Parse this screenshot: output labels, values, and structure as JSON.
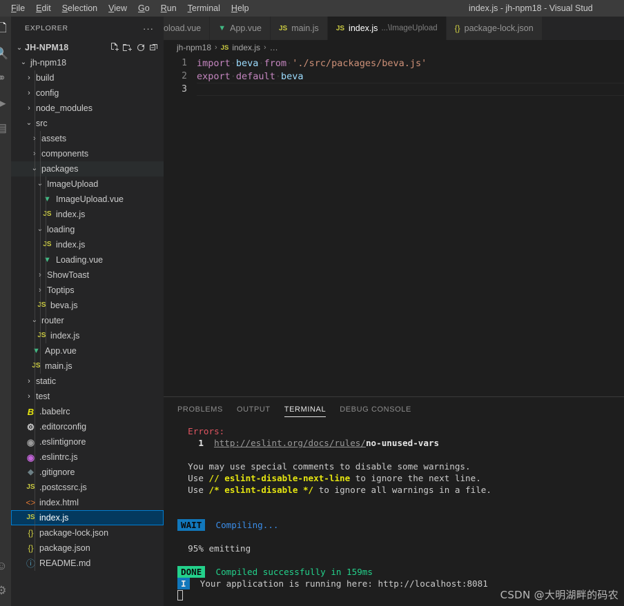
{
  "window": {
    "title": "index.js - jh-npm18 - Visual Stud"
  },
  "menubar": {
    "items": [
      {
        "label": "File"
      },
      {
        "label": "Edit"
      },
      {
        "label": "Selection"
      },
      {
        "label": "View"
      },
      {
        "label": "Go"
      },
      {
        "label": "Run"
      },
      {
        "label": "Terminal"
      },
      {
        "label": "Help"
      }
    ]
  },
  "sidebar": {
    "title": "EXPLORER",
    "more_actions": "···",
    "root": {
      "label": "JH-NPM18",
      "chevron": "⌄",
      "actions": [
        {
          "name": "new-file-icon",
          "title": "New File"
        },
        {
          "name": "new-folder-icon",
          "title": "New Folder"
        },
        {
          "name": "refresh-icon",
          "title": "Refresh Explorer"
        },
        {
          "name": "collapse-all-icon",
          "title": "Collapse Folders in Explorer"
        }
      ]
    },
    "tree": [
      {
        "label": "jh-npm18",
        "depth": 0,
        "kind": "folder",
        "expanded": true,
        "icon": "chevron-down",
        "state": "none"
      },
      {
        "label": "build",
        "depth": 1,
        "kind": "folder",
        "expanded": false,
        "icon": "chevron-right",
        "state": "none"
      },
      {
        "label": "config",
        "depth": 1,
        "kind": "folder",
        "expanded": false,
        "icon": "chevron-right",
        "state": "none"
      },
      {
        "label": "node_modules",
        "depth": 1,
        "kind": "folder",
        "expanded": false,
        "icon": "chevron-right",
        "state": "none"
      },
      {
        "label": "src",
        "depth": 1,
        "kind": "folder",
        "expanded": true,
        "icon": "chevron-down",
        "state": "none"
      },
      {
        "label": "assets",
        "depth": 2,
        "kind": "folder",
        "expanded": false,
        "icon": "chevron-right",
        "state": "none"
      },
      {
        "label": "components",
        "depth": 2,
        "kind": "folder",
        "expanded": false,
        "icon": "chevron-right",
        "state": "none"
      },
      {
        "label": "packages",
        "depth": 2,
        "kind": "folder",
        "expanded": true,
        "icon": "chevron-down",
        "state": "hover"
      },
      {
        "label": "ImageUpload",
        "depth": 3,
        "kind": "folder",
        "expanded": true,
        "icon": "chevron-down",
        "state": "none"
      },
      {
        "label": "ImageUpload.vue",
        "depth": 4,
        "kind": "file",
        "filetype": "vue",
        "state": "none"
      },
      {
        "label": "index.js",
        "depth": 4,
        "kind": "file",
        "filetype": "js",
        "state": "none"
      },
      {
        "label": "loading",
        "depth": 3,
        "kind": "folder",
        "expanded": true,
        "icon": "chevron-down",
        "state": "none"
      },
      {
        "label": "index.js",
        "depth": 4,
        "kind": "file",
        "filetype": "js",
        "state": "none"
      },
      {
        "label": "Loading.vue",
        "depth": 4,
        "kind": "file",
        "filetype": "vue",
        "state": "none"
      },
      {
        "label": "ShowToast",
        "depth": 3,
        "kind": "folder",
        "expanded": false,
        "icon": "chevron-right",
        "state": "none"
      },
      {
        "label": "Toptips",
        "depth": 3,
        "kind": "folder",
        "expanded": false,
        "icon": "chevron-right",
        "state": "none"
      },
      {
        "label": "beva.js",
        "depth": 3,
        "kind": "file",
        "filetype": "js",
        "state": "none"
      },
      {
        "label": "router",
        "depth": 2,
        "kind": "folder",
        "expanded": true,
        "icon": "chevron-down",
        "state": "none"
      },
      {
        "label": "index.js",
        "depth": 3,
        "kind": "file",
        "filetype": "js",
        "state": "none"
      },
      {
        "label": "App.vue",
        "depth": 2,
        "kind": "file",
        "filetype": "vue",
        "state": "none"
      },
      {
        "label": "main.js",
        "depth": 2,
        "kind": "file",
        "filetype": "js",
        "state": "none"
      },
      {
        "label": "static",
        "depth": 1,
        "kind": "folder",
        "expanded": false,
        "icon": "chevron-right",
        "state": "none"
      },
      {
        "label": "test",
        "depth": 1,
        "kind": "folder",
        "expanded": false,
        "icon": "chevron-right",
        "state": "none"
      },
      {
        "label": ".babelrc",
        "depth": 1,
        "kind": "file",
        "filetype": "babel",
        "state": "none"
      },
      {
        "label": ".editorconfig",
        "depth": 1,
        "kind": "file",
        "filetype": "editorconfig",
        "state": "none"
      },
      {
        "label": ".eslintignore",
        "depth": 1,
        "kind": "file",
        "filetype": "eslintignore",
        "state": "none"
      },
      {
        "label": ".eslintrc.js",
        "depth": 1,
        "kind": "file",
        "filetype": "eslintrc",
        "state": "none"
      },
      {
        "label": ".gitignore",
        "depth": 1,
        "kind": "file",
        "filetype": "git",
        "state": "none"
      },
      {
        "label": ".postcssrc.js",
        "depth": 1,
        "kind": "file",
        "filetype": "js",
        "state": "none"
      },
      {
        "label": "index.html",
        "depth": 1,
        "kind": "file",
        "filetype": "html",
        "state": "none"
      },
      {
        "label": "index.js",
        "depth": 1,
        "kind": "file",
        "filetype": "js",
        "state": "selected"
      },
      {
        "label": "package-lock.json",
        "depth": 1,
        "kind": "file",
        "filetype": "json",
        "state": "none"
      },
      {
        "label": "package.json",
        "depth": 1,
        "kind": "file",
        "filetype": "json",
        "state": "none"
      },
      {
        "label": "README.md",
        "depth": 1,
        "kind": "file",
        "filetype": "md",
        "state": "none"
      }
    ]
  },
  "editor": {
    "tabs": [
      {
        "label": "oload.vue",
        "icon": "none",
        "description": "",
        "active": false,
        "partial": true
      },
      {
        "label": "App.vue",
        "icon": "vue",
        "description": "",
        "active": false,
        "partial": false
      },
      {
        "label": "main.js",
        "icon": "js",
        "description": "",
        "active": false,
        "partial": false
      },
      {
        "label": "index.js",
        "icon": "js",
        "description": "...\\ImageUpload",
        "active": true,
        "partial": false
      },
      {
        "label": "package-lock.json",
        "icon": "json",
        "description": "",
        "active": false,
        "partial": false
      }
    ],
    "breadcrumb": {
      "root": "jh-npm18",
      "file": "index.js",
      "file_icon": "js",
      "tail": "…",
      "separator": "›"
    },
    "lines": [
      {
        "number": "1",
        "tokens": [
          {
            "text": "import",
            "type": "kw"
          },
          {
            "text": "·",
            "type": "sp"
          },
          {
            "text": "beva",
            "type": "var"
          },
          {
            "text": "·",
            "type": "sp"
          },
          {
            "text": "from",
            "type": "kw"
          },
          {
            "text": "·",
            "type": "sp"
          },
          {
            "text": "'./src/packages/beva.js'",
            "type": "str"
          }
        ]
      },
      {
        "number": "2",
        "tokens": [
          {
            "text": "export",
            "type": "kw"
          },
          {
            "text": "·",
            "type": "sp"
          },
          {
            "text": "default",
            "type": "kw"
          },
          {
            "text": "·",
            "type": "sp"
          },
          {
            "text": "beva",
            "type": "var"
          }
        ]
      },
      {
        "number": "3",
        "tokens": [],
        "current": true
      }
    ]
  },
  "panel": {
    "tabs": [
      {
        "label": "PROBLEMS",
        "active": false
      },
      {
        "label": "OUTPUT",
        "active": false
      },
      {
        "label": "TERMINAL",
        "active": true
      },
      {
        "label": "DEBUG CONSOLE",
        "active": false
      }
    ],
    "terminal_lines": [
      {
        "id": "l1",
        "segments": [
          {
            "text": "  Errors:",
            "cls": "t-red"
          }
        ]
      },
      {
        "id": "l2",
        "segments": [
          {
            "text": "    1  ",
            "cls": "t-white-b"
          },
          {
            "text": "http://eslint.org/docs/rules/",
            "cls": "t-link"
          },
          {
            "text": "no-unused-vars",
            "cls": "t-white-b"
          }
        ]
      },
      {
        "id": "l3",
        "segments": [
          {
            "text": "",
            "cls": "t-plain"
          }
        ]
      },
      {
        "id": "l4",
        "segments": [
          {
            "text": "  You may use special comments to disable some warnings.",
            "cls": "t-plain"
          }
        ]
      },
      {
        "id": "l5",
        "segments": [
          {
            "text": "  Use ",
            "cls": "t-plain"
          },
          {
            "text": "// eslint-disable-next-line",
            "cls": "t-yellow"
          },
          {
            "text": " to ignore the next line.",
            "cls": "t-plain"
          }
        ]
      },
      {
        "id": "l6",
        "segments": [
          {
            "text": "  Use ",
            "cls": "t-plain"
          },
          {
            "text": "/* eslint-disable */",
            "cls": "t-yellow"
          },
          {
            "text": " to ignore all warnings in a file.",
            "cls": "t-plain"
          }
        ]
      },
      {
        "id": "l7",
        "segments": [
          {
            "text": "",
            "cls": "t-plain"
          }
        ]
      },
      {
        "id": "l8",
        "segments": [
          {
            "text": "",
            "cls": "t-plain"
          }
        ]
      },
      {
        "id": "l9",
        "badge": {
          "text": "WAIT",
          "style": "badge-wait"
        },
        "segments": [
          {
            "text": "  Compiling...",
            "cls": "t-blue"
          }
        ]
      },
      {
        "id": "l10",
        "segments": [
          {
            "text": "",
            "cls": "t-plain"
          }
        ]
      },
      {
        "id": "l11",
        "segments": [
          {
            "text": "  95% emitting",
            "cls": "t-plain"
          }
        ]
      },
      {
        "id": "l12",
        "segments": [
          {
            "text": "",
            "cls": "t-plain"
          }
        ]
      },
      {
        "id": "l13",
        "badge": {
          "text": "DONE",
          "style": "badge-done"
        },
        "segments": [
          {
            "text": "  Compiled successfully in 159ms",
            "cls": "t-green"
          }
        ]
      },
      {
        "id": "l14",
        "badge": {
          "text": "I",
          "style": "badge-i"
        },
        "segments": [
          {
            "text": "  Your application is running here: http://localhost:8081",
            "cls": "t-plain"
          }
        ]
      }
    ],
    "cursor": "block"
  },
  "watermark": {
    "text": "CSDN @大明湖畔的码农"
  },
  "colors": {
    "accent": "#007fd4",
    "selection_bg": "#04395e",
    "editor_bg": "#1e1e1e",
    "sidebar_bg": "#252526",
    "titlebar_bg": "#3c3c3c",
    "keyword": "#c586c0",
    "variable": "#9cdcfe",
    "string": "#ce9178",
    "js_icon": "#cbcb41",
    "vue_icon": "#41b883",
    "json_icon": "#cbcb41",
    "error_red": "#e05561",
    "success_green": "#23d18b",
    "info_blue": "#3b8eea",
    "warn_yellow": "#e5e510"
  }
}
